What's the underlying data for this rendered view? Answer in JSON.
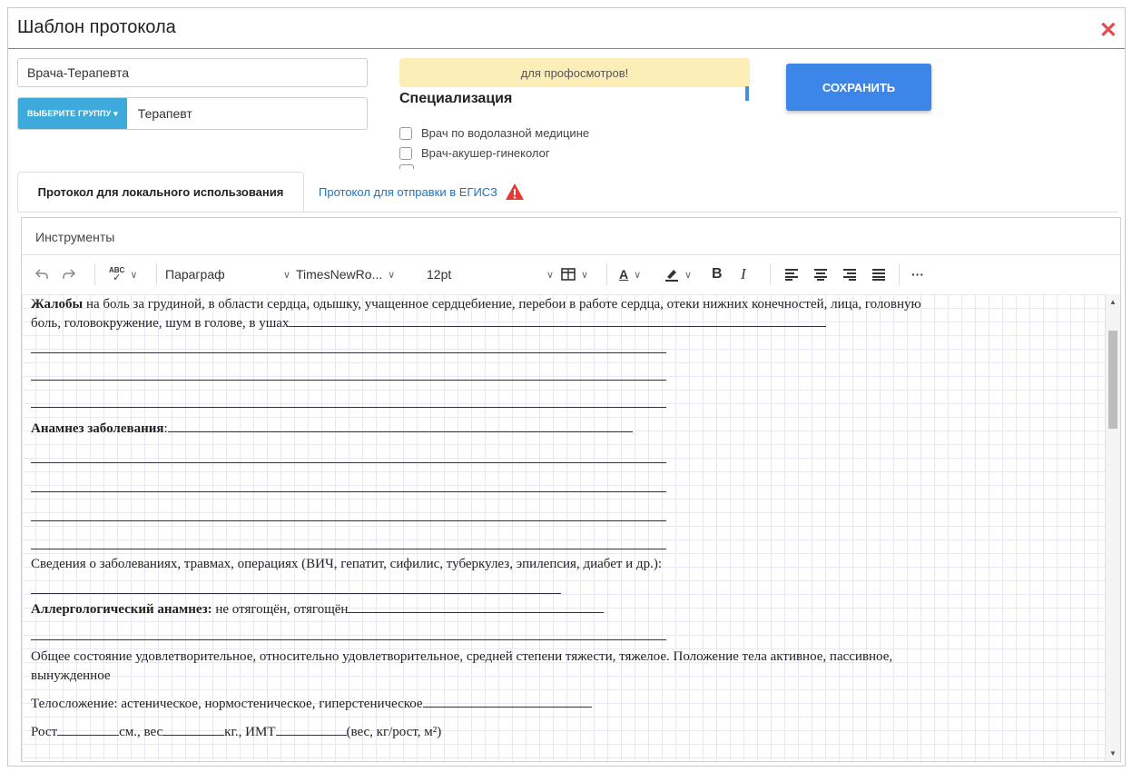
{
  "dialog": {
    "title": "Шаблон протокола",
    "close_glyph": "✕"
  },
  "form": {
    "name_value": "Врача-Терапевта",
    "group_button_label": "ВЫБЕРИТЕ ГРУППУ ▾",
    "group_value": "Терапевт",
    "note_text": "для профосмотров!",
    "save_label": "СОХРАНИТЬ"
  },
  "specialization": {
    "title": "Специализация",
    "items": [
      "Врач по водолазной медицине",
      "Врач-акушер-гинеколог"
    ]
  },
  "tabs": [
    {
      "label": "Протокол для локального использования",
      "active": true
    },
    {
      "label": "Протокол для отправки в ЕГИСЗ",
      "active": false,
      "icon": "warning-icon"
    }
  ],
  "editor": {
    "menubar_label": "Инструменты",
    "toolbar": {
      "block_format": "Параграф",
      "font_family": "TimesNewRo...",
      "font_size": "12pt",
      "spellcheck_glyph": "ABC",
      "bold_glyph": "B",
      "italic_glyph": "I",
      "text_color_glyph": "A",
      "more_glyph": "···"
    },
    "content": {
      "complaints_label": "Жалобы",
      "complaints_text": " на боль за грудиной, в области сердца, одышку, учащенное сердцебиение, перебои в работе сердца, отеки нижних конечностей, лица, головную",
      "complaints_text2": "боль, головокружение, шум в голове, в ушах",
      "anamnesis_label": "Анамнез заболевания",
      "anamnesis_suffix": ":",
      "diseases_text": "Сведения о заболеваниях, травмах, операциях (ВИЧ, гепатит, сифилис, туберкулез, эпилепсия, диабет и др.):",
      "allergy_label": "Аллергологический анамнез:",
      "allergy_text": " не отягощён, отягощён",
      "general_text": "Общее состояние удовлетворительное, относительно удовлетворительное, средней степени тяжести, тяжелое. Положение тела активное, пассивное,",
      "general_text2": "вынужденное",
      "body_type_text": "Телосложение: астеническое, нормостеническое, гиперстеническое",
      "height_label": "Рост",
      "height_unit": "см., вес",
      "weight_unit": "кг., ИМТ",
      "bmi_unit": "(вес, кг/рост, м²)"
    }
  },
  "colors": {
    "accent": "#3b86e8",
    "group_button": "#3ea9db",
    "note_bg": "#fdeeb8",
    "close": "#e05050",
    "warning": "#e53935"
  }
}
